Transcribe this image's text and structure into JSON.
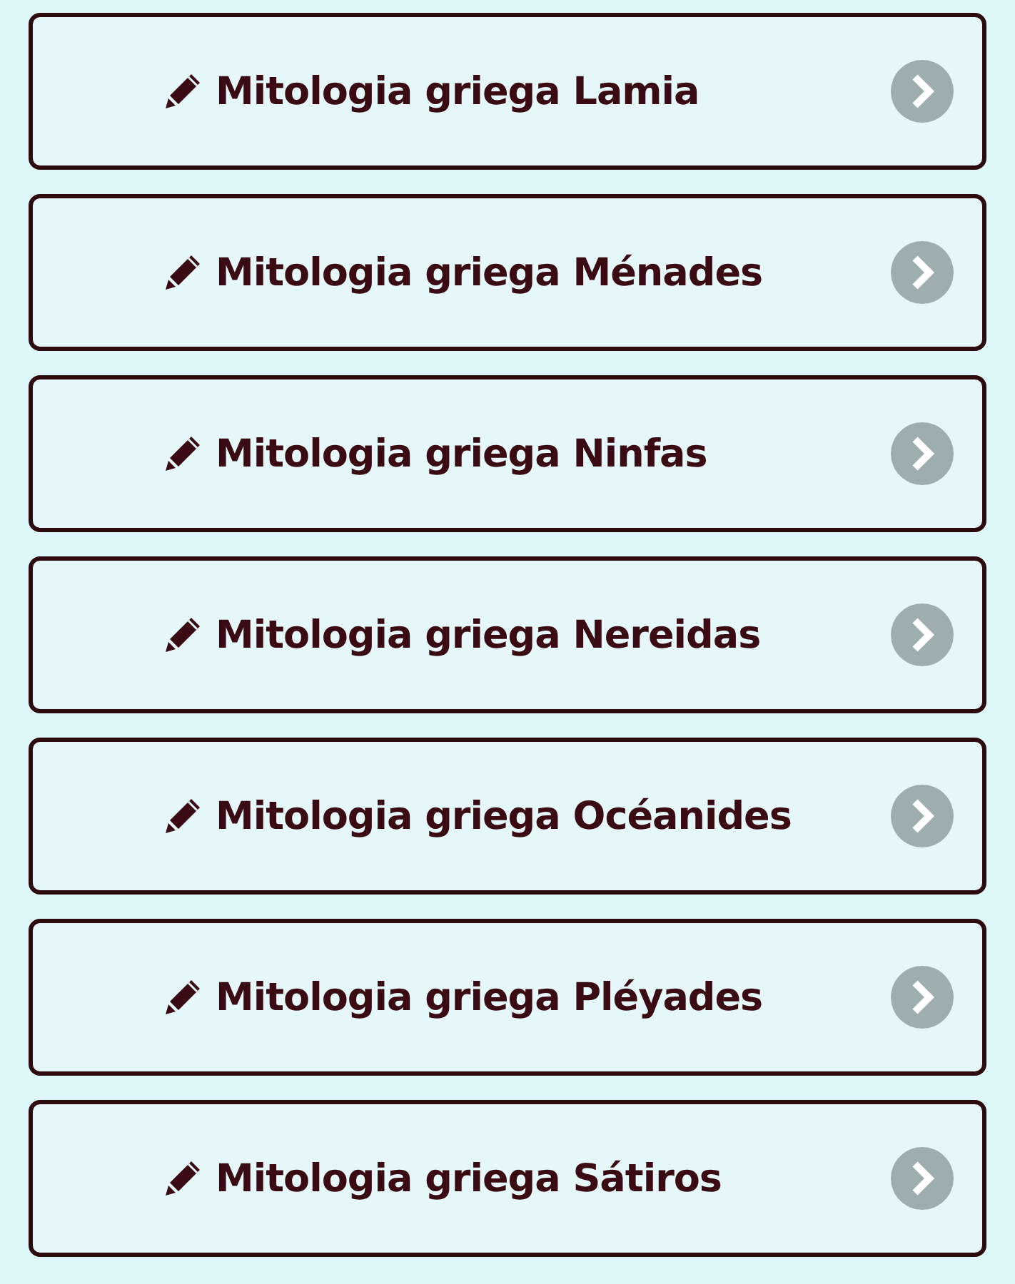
{
  "items": [
    {
      "label": "Mitologia griega Lamia"
    },
    {
      "label": "Mitologia griega Ménades"
    },
    {
      "label": "Mitologia griega Ninfas"
    },
    {
      "label": "Mitologia griega Nereidas"
    },
    {
      "label": "Mitologia griega Océanides"
    },
    {
      "label": "Mitologia griega Pléyades"
    },
    {
      "label": "Mitologia griega Sátiros"
    }
  ]
}
